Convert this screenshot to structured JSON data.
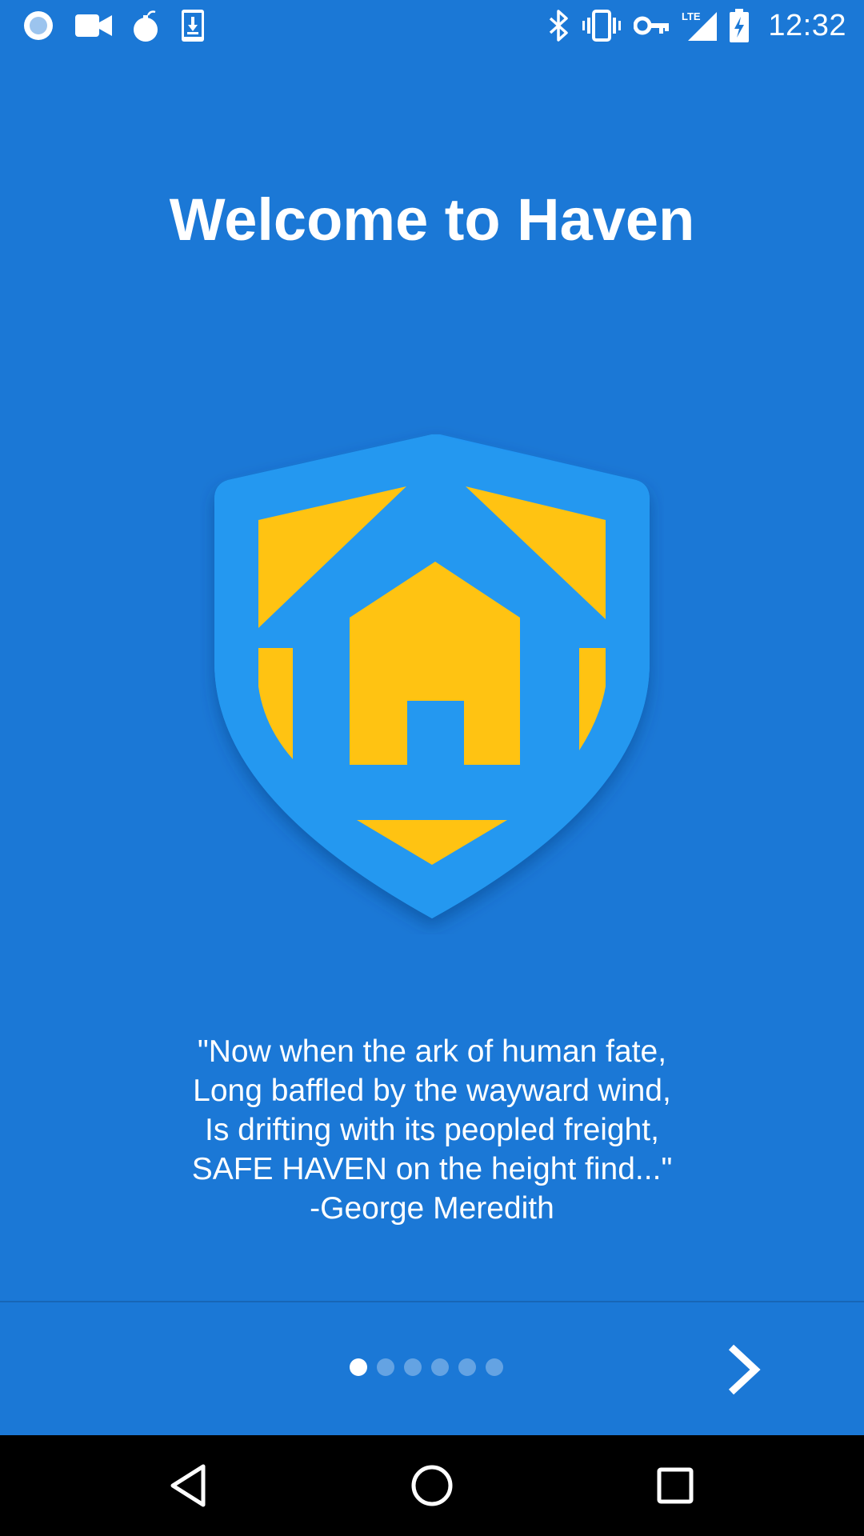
{
  "status_bar": {
    "time": "12:32",
    "network_label": "LTE",
    "icons_left": [
      "record-icon",
      "video-camera-icon",
      "bomb-icon",
      "download-icon"
    ],
    "icons_right": [
      "bluetooth-icon",
      "vibrate-icon",
      "vpn-key-icon",
      "lte-signal-icon",
      "battery-charging-icon"
    ]
  },
  "welcome": {
    "title": "Welcome to Haven"
  },
  "quote": {
    "lines": [
      "\"Now when the ark of human fate,",
      "Long baffled by the wayward wind,",
      "Is drifting with its peopled freight,",
      "SAFE HAVEN on the height find...\"",
      "-George Meredith"
    ]
  },
  "pager": {
    "page_count": 6,
    "current_page": 1
  },
  "icons": {
    "logo": "haven-shield-logo",
    "next": "chevron-right-icon",
    "back": "back-triangle-icon",
    "home": "home-circle-icon",
    "recents": "recents-square-icon"
  },
  "colors": {
    "background": "#1B78D6",
    "shield": "#2196F3",
    "accent": "#FFC312",
    "nav_bar": "#000000"
  }
}
